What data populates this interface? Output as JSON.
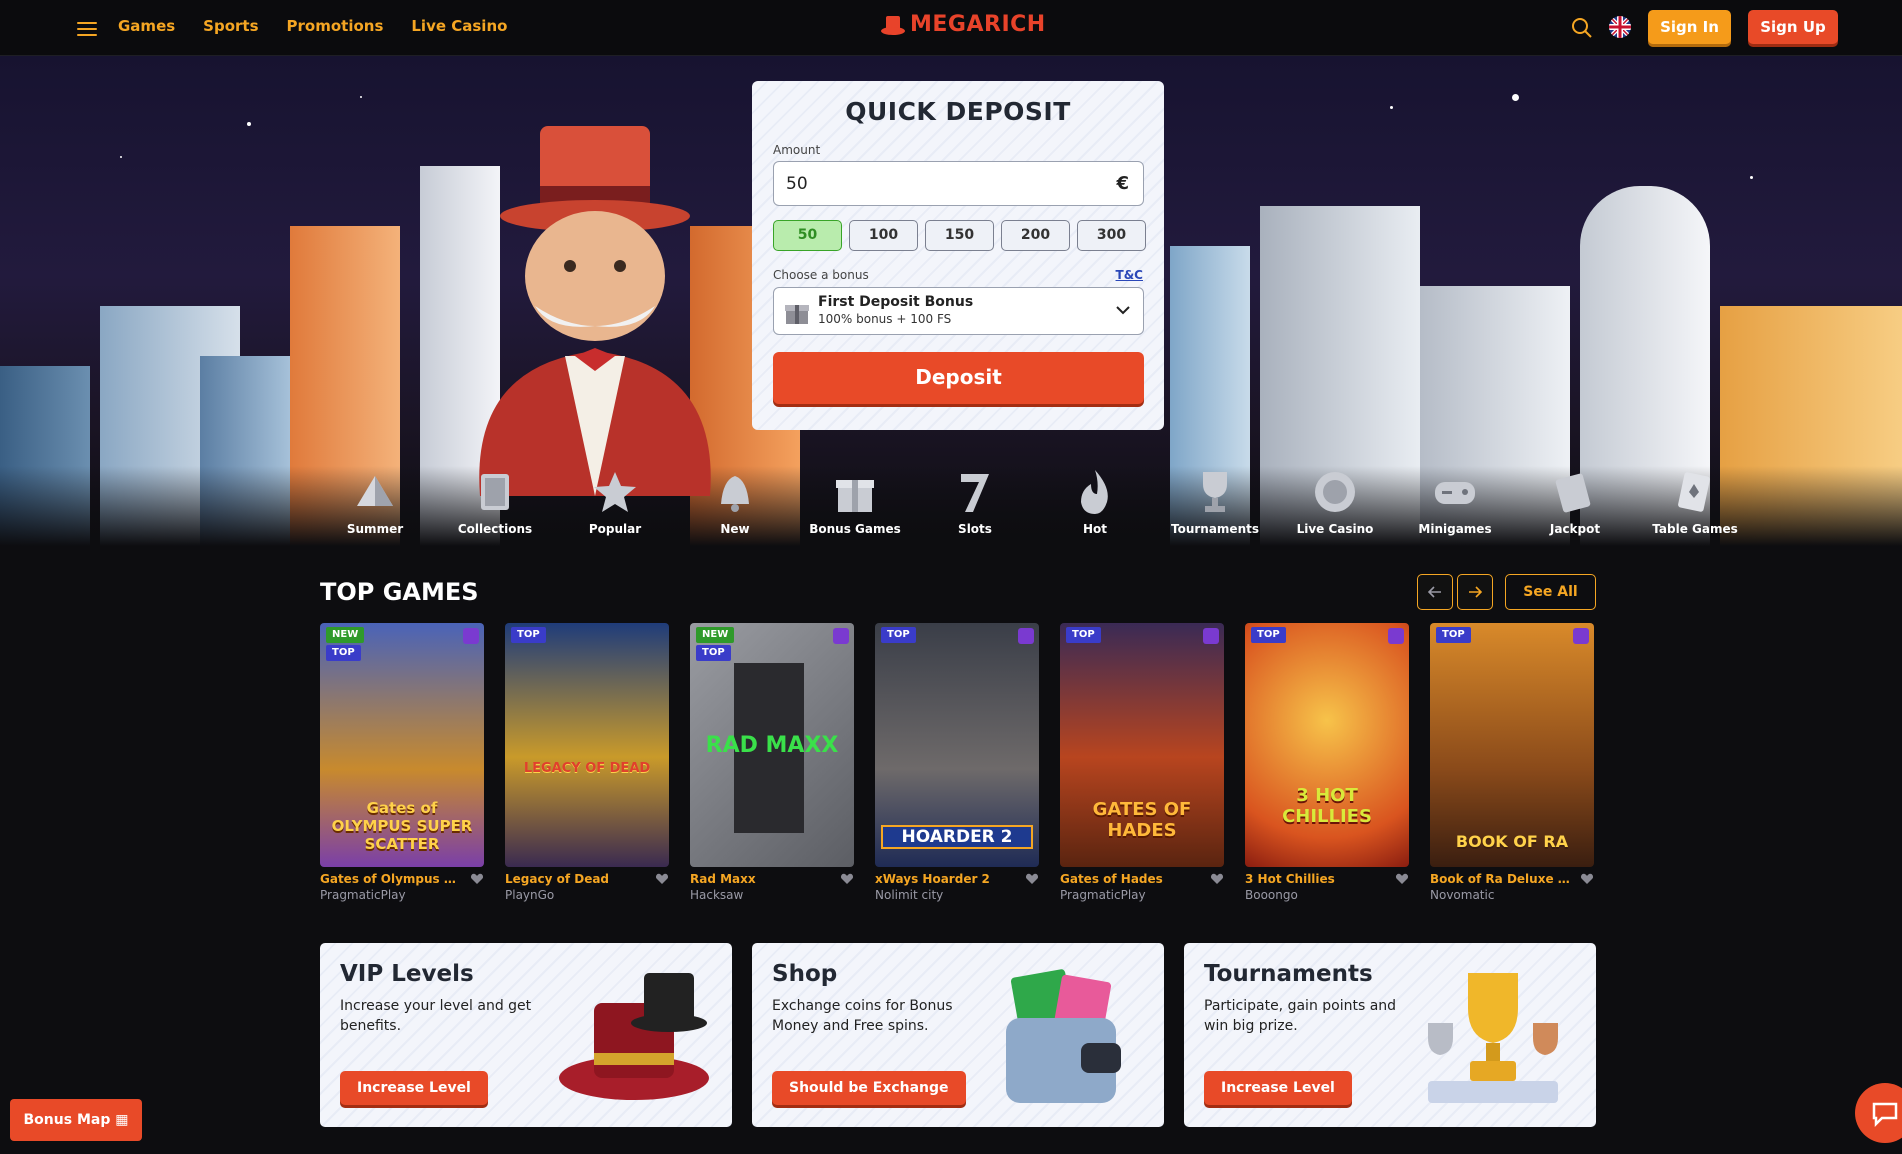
{
  "header": {
    "nav": [
      "Games",
      "Sports",
      "Promotions",
      "Live Casino"
    ],
    "logo_text": "MEGARICH",
    "signin_label": "Sign In",
    "signup_label": "Sign Up"
  },
  "quick_deposit": {
    "title": "QUICK DEPOSIT",
    "amount_label": "Amount",
    "amount_value": "50",
    "currency": "€",
    "chips": [
      "50",
      "100",
      "150",
      "200",
      "300"
    ],
    "selected_chip": "50",
    "bonus_label": "Choose a bonus",
    "tc_label": "T&C",
    "bonus_name": "First Deposit Bonus",
    "bonus_desc": "100% bonus + 100 FS",
    "deposit_label": "Deposit"
  },
  "categories": [
    {
      "label": "Summer",
      "icon": "summer-icon"
    },
    {
      "label": "Collections",
      "icon": "collections-icon"
    },
    {
      "label": "Popular",
      "icon": "star-icon"
    },
    {
      "label": "New",
      "icon": "bell-icon"
    },
    {
      "label": "Bonus Games",
      "icon": "gift-icon"
    },
    {
      "label": "Slots",
      "icon": "seven-icon"
    },
    {
      "label": "Hot",
      "icon": "fire-icon"
    },
    {
      "label": "Tournaments",
      "icon": "trophy-icon"
    },
    {
      "label": "Live Casino",
      "icon": "chip-icon"
    },
    {
      "label": "Minigames",
      "icon": "gamepad-icon"
    },
    {
      "label": "Jackpot",
      "icon": "jackpot-icon"
    },
    {
      "label": "Table Games",
      "icon": "cards-icon"
    }
  ],
  "top_games": {
    "title": "TOP GAMES",
    "see_all_label": "See All",
    "games": [
      {
        "name": "Gates of Olympus Su...",
        "provider": "PragmaticPlay",
        "badges": [
          "NEW",
          "TOP"
        ],
        "thumb_text": "Gates of OLYMPUS SUPER SCATTER"
      },
      {
        "name": "Legacy of Dead",
        "provider": "PlaynGo",
        "badges": [
          "TOP"
        ],
        "thumb_text": "LEGACY OF DEAD"
      },
      {
        "name": "Rad Maxx",
        "provider": "Hacksaw",
        "badges": [
          "NEW",
          "TOP"
        ],
        "thumb_text": "RAD MAXX"
      },
      {
        "name": "xWays Hoarder 2",
        "provider": "Nolimit city",
        "badges": [
          "TOP"
        ],
        "thumb_text": "HOARDER 2"
      },
      {
        "name": "Gates of Hades",
        "provider": "PragmaticPlay",
        "badges": [
          "TOP"
        ],
        "thumb_text": "GATES OF HADES"
      },
      {
        "name": "3 Hot Chillies",
        "provider": "Booongo",
        "badges": [
          "TOP"
        ],
        "thumb_text": "3 HOT CHILLIES"
      },
      {
        "name": "Book of Ra Deluxe Bu...",
        "provider": "Novomatic",
        "badges": [
          "TOP"
        ],
        "thumb_text": "BOOK OF RA"
      }
    ]
  },
  "promos": [
    {
      "title": "VIP Levels",
      "desc": "Increase your level and get benefits.",
      "button": "Increase Level"
    },
    {
      "title": "Shop",
      "desc": "Exchange coins for Bonus Money and Free spins.",
      "button": "Should be Exchange"
    },
    {
      "title": "Tournaments",
      "desc": "Participate, gain points and win big prize.",
      "button": "Increase Level"
    }
  ],
  "bonus_map_label": "Bonus Map",
  "colors": {
    "accent": "#f5a623",
    "brand_red": "#e84a28",
    "bg": "#0d0d10"
  }
}
